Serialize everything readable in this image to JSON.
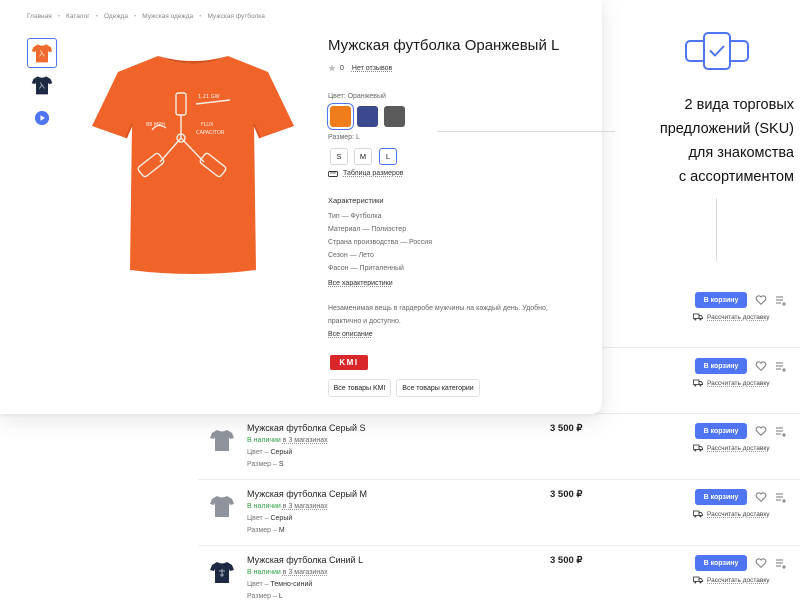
{
  "breadcrumbs": [
    "Главная",
    "Каталог",
    "Одежда",
    "Мужская одежда",
    "Мужская футболка"
  ],
  "product": {
    "title": "Мужская футболка Оранжевый L",
    "rating_value": "0",
    "reviews_label": "Нет отзывов",
    "color_label": "Цвет: Оранжевый",
    "colors": [
      {
        "name": "orange",
        "hex": "#f07d1c",
        "selected": true
      },
      {
        "name": "navy",
        "hex": "#3b4a8f",
        "selected": false
      },
      {
        "name": "gray",
        "hex": "#5a5a5a",
        "selected": false
      }
    ],
    "size_label": "Размер: L",
    "sizes": [
      {
        "label": "S",
        "selected": false
      },
      {
        "label": "M",
        "selected": false
      },
      {
        "label": "L",
        "selected": true
      }
    ],
    "size_table_label": "Таблица размеров",
    "characteristics_title": "Характеристики",
    "characteristics": [
      "Тип — Футболка",
      "Материал — Полиэстер",
      "Страна производства — Россия",
      "Сезон — Лето",
      "Фасон — Приталенный"
    ],
    "all_characteristics_label": "Все характеристики",
    "description": "Незаменимая вещь в гардеробе мужчины на каждый день. Удобно, практично и доступно.",
    "all_description_label": "Все описание",
    "brand_logo_text": "KMI",
    "all_brand_button": "Все товары KMI",
    "all_category_button": "Все товары категории"
  },
  "list": {
    "cart_label": "В корзину",
    "delivery_label": "Рассчитать доставку",
    "rows": [
      {
        "name": "Мужская футболка Серый S",
        "stock": "В наличии",
        "shops": "в 3 магазинах",
        "color_key": "Цвет –",
        "color_val": "Серый",
        "size_key": "Размер –",
        "size_val": "S",
        "price": "3 500 ₽",
        "thumb": "gray"
      },
      {
        "name": "Мужская футболка Серый M",
        "stock": "В наличии",
        "shops": "в 3 магазинах",
        "color_key": "Цвет –",
        "color_val": "Серый",
        "size_key": "Размер –",
        "size_val": "M",
        "price": "3 500 ₽",
        "thumb": "gray"
      },
      {
        "name": "Мужская футболка Синий L",
        "stock": "В наличии",
        "shops": "в 3 магазинах",
        "color_key": "Цвет –",
        "color_val": "Темно-синий",
        "size_key": "Размер –",
        "size_val": "L",
        "price": "3 500 ₽",
        "thumb": "navy"
      }
    ]
  },
  "annotation": {
    "lines": [
      "2 вида торговых",
      "предложений (SKU)",
      "для знакомства",
      "с ассортиментом"
    ],
    "accent": "#4f75f2"
  }
}
